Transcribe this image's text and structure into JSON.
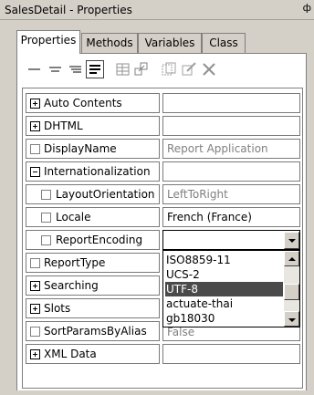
{
  "window": {
    "title": "SalesDetail - Properties",
    "pin_glyph": "ф"
  },
  "tabs": [
    {
      "label": "Properties",
      "active": true
    },
    {
      "label": "Methods",
      "active": false
    },
    {
      "label": "Variables",
      "active": false
    },
    {
      "label": "Class",
      "active": false
    }
  ],
  "toolbar": {
    "icons": [
      "align-left-icon",
      "align-center-icon",
      "align-right-icon",
      "align-justify-icon",
      "table-icon",
      "link-icon",
      "copy-icon",
      "edit-icon",
      "delete-icon"
    ]
  },
  "grid": {
    "rows": [
      {
        "label": "Auto Contents",
        "value": "",
        "marker": "plus"
      },
      {
        "label": "DHTML",
        "value": "",
        "marker": "plus"
      },
      {
        "label": "DisplayName",
        "value": "Report Application",
        "marker": "box"
      },
      {
        "label": "Internationalization",
        "value": "",
        "marker": "minus"
      },
      {
        "label": "LayoutOrientation",
        "value": "LeftToRight",
        "marker": "box"
      },
      {
        "label": "Locale",
        "value": "French (France)",
        "marker": "box"
      },
      {
        "label": "ReportEncoding",
        "value": "",
        "marker": "box"
      },
      {
        "label": "ReportType",
        "value": "",
        "marker": "box"
      },
      {
        "label": "Searching",
        "value": "",
        "marker": "plus"
      },
      {
        "label": "Slots",
        "value": "",
        "marker": "plus"
      },
      {
        "label": "SortParamsByAlias",
        "value": "False",
        "marker": "box"
      },
      {
        "label": "XML Data",
        "value": "",
        "marker": "plus"
      }
    ]
  },
  "dropdown": {
    "options": [
      "ISO8859-11",
      "UCS-2",
      "UTF-8",
      "actuate-thai",
      "gb18030"
    ],
    "selected": "UTF-8"
  },
  "colors": {
    "background": "#d4d0c8",
    "selection": "#4a4a4a",
    "muted_text": "#808080"
  }
}
